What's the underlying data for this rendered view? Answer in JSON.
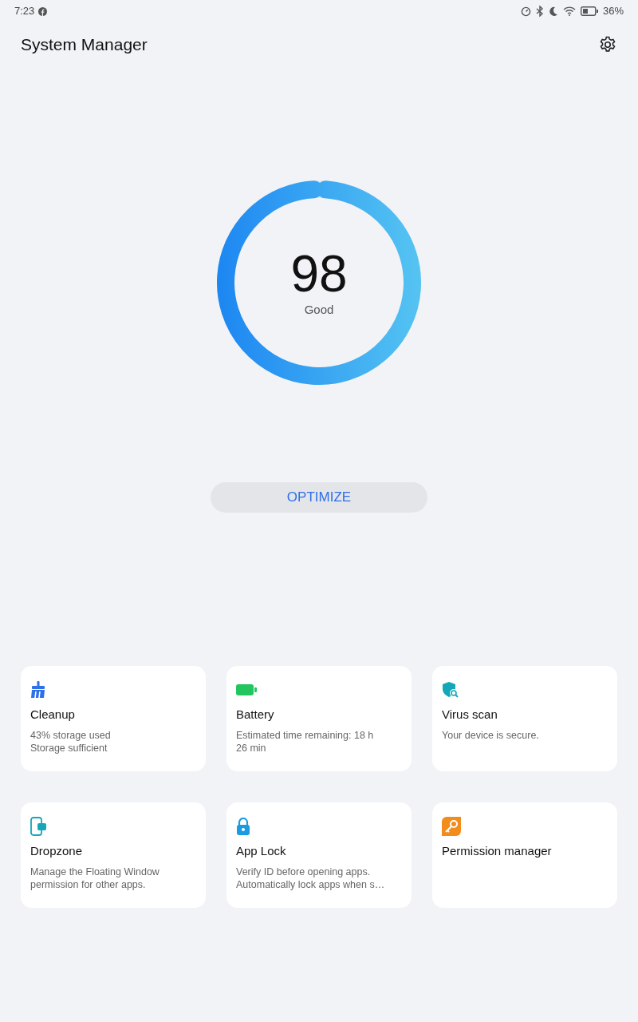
{
  "status_bar": {
    "time": "7:23",
    "battery": "36%"
  },
  "header": {
    "title": "System Manager"
  },
  "score": {
    "value": "98",
    "label": "Good",
    "level": 0.98
  },
  "optimize_button": "OPTIMIZE",
  "cards": [
    {
      "kind": "cleanup",
      "title": "Cleanup",
      "lines": [
        "43% storage used",
        "Storage sufficient"
      ]
    },
    {
      "kind": "battery",
      "title": "Battery",
      "lines": [
        "Estimated time remaining: 18 h",
        "26 min"
      ]
    },
    {
      "kind": "virus",
      "title": "Virus scan",
      "lines": [
        "Your device is secure."
      ]
    },
    {
      "kind": "dropzone",
      "title": "Dropzone",
      "lines": [
        "Manage the Floating Window",
        "permission for other apps."
      ]
    },
    {
      "kind": "lock",
      "title": "App Lock",
      "lines": [
        "Verify ID before opening apps.",
        "Automatically lock apps when s…"
      ]
    },
    {
      "kind": "permission",
      "title": "Permission manager"
    }
  ]
}
